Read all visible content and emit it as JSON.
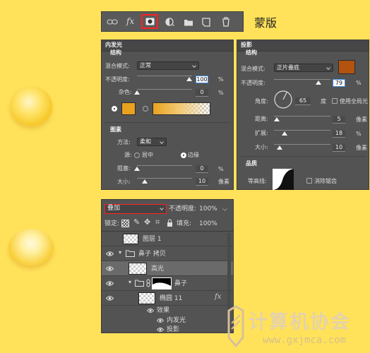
{
  "toolbar": {
    "icons": [
      "link-icon",
      "fx-icon",
      "mask-icon",
      "adjustment-icon",
      "folder-icon",
      "new-layer-icon",
      "trash-icon"
    ],
    "fx_label": "fx"
  },
  "annotation": {
    "mask_label": "蒙版"
  },
  "inner_glow": {
    "title": "内发光",
    "structure_title": "结构",
    "blend_mode_label": "混合模式:",
    "blend_mode_value": "正常",
    "opacity_label": "不透明度:",
    "opacity_value": "100",
    "noise_label": "杂色:",
    "noise_value": "0",
    "percent": "%",
    "color": "#e8a21f",
    "elements_title": "图素",
    "method_label": "方法:",
    "method_value": "柔和",
    "source_label": "源:",
    "source_center": "居中",
    "source_edge": "边缘",
    "choke_label": "阻塞:",
    "choke_value": "0",
    "size_label": "大小:",
    "size_value": "10",
    "px_unit": "像素"
  },
  "drop_shadow": {
    "title": "投影",
    "structure_title": "结构",
    "blend_mode_label": "混合模式:",
    "blend_mode_value": "正片叠底",
    "color": "#b3530f",
    "opacity_label": "不透明度:",
    "opacity_value": "79",
    "angle_label": "角度:",
    "angle_value": "65",
    "degree_unit": "度",
    "global_light_label": "使用全局光",
    "distance_label": "距离:",
    "distance_value": "5",
    "spread_label": "扩展:",
    "spread_value": "18",
    "size_label": "大小:",
    "size_value": "10",
    "px_unit": "像素",
    "percent": "%",
    "quality_title": "品质",
    "contour_label": "等高线:",
    "antialias_label": "消除锯齿"
  },
  "layers": {
    "blend_mode": "叠加",
    "opacity_label": "不透明度:",
    "opacity_value": "100%",
    "lock_label": "锁定:",
    "fill_label": "填充:",
    "fill_value": "100%",
    "items": [
      {
        "name": "图层 1"
      },
      {
        "name": "鼻子 拷贝"
      },
      {
        "name": "高光"
      },
      {
        "name": "鼻子"
      },
      {
        "name": "椭圆 11",
        "fx": "fx"
      },
      {
        "name": "效果"
      },
      {
        "name": "内发光"
      },
      {
        "name": "投影"
      }
    ]
  },
  "watermark": {
    "title": "计算机协会",
    "url": "www.gxjmca.com"
  }
}
